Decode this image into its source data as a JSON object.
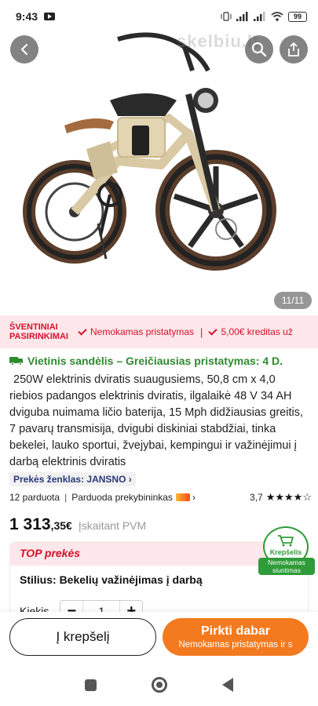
{
  "status_bar": {
    "time": "9:43",
    "battery": "99",
    "icons": [
      "youtube-icon",
      "vibrate-icon",
      "signal-icon",
      "signal-icon",
      "wifi-icon",
      "battery-icon"
    ]
  },
  "hero": {
    "watermark": "skelbiu.lt",
    "image_counter": "11/11",
    "icons": [
      "back-icon",
      "search-icon",
      "share-icon"
    ]
  },
  "promo": {
    "title_line1": "ŠVENTINIAI",
    "title_line2": "PASIRINKIMAI",
    "item1": "Nemokamas pristatymas",
    "separator": "|",
    "item2": "5,00€ kreditas už"
  },
  "product": {
    "warehouse": "Vietinis sandėlis – Greičiausias pristatymas: 4 D.",
    "description": "250W elektrinis dviratis suaugusiems, 50,8 cm x 4,0 riebios padangos elektrinis dviratis, ilgalaikė 48 V 34 AH dviguba nuimama ličio baterija, 15 Mph didžiausias greitis, 7 pavarų transmisija, dvigubi diskiniai stabdžiai, tinka bekelei, lauko sportui, žvejybai, kempingui ir važinėjimui į darbą elektrinis dviratis",
    "brand_label": "Prekės ženklas:",
    "brand_value": "JANSNO",
    "sold": "12 parduota",
    "sold_by": "Parduoda prekybininkas",
    "rating": "3,7",
    "stars": "★★★★☆",
    "price_main": "1 313",
    "price_cents": ",35€",
    "price_vat": "Įskaitant PVM"
  },
  "top_card": {
    "title": "TOP prekės",
    "style_label": "Stilius:",
    "style_value": "Bekelių važinėjimas į darbą",
    "qty_label": "Kiekis",
    "qty_minus": "−",
    "qty_value": "1",
    "qty_plus": "+"
  },
  "cart_badge": {
    "label": "Krepšelis",
    "ribbon_line1": "Nemokamas",
    "ribbon_line2": "siuntimas"
  },
  "actions": {
    "add_to_cart": "Į krepšelį",
    "buy_now": "Pirkti dabar",
    "buy_now_sub": "Nemokamas pristatymas ir s"
  },
  "colors": {
    "accent_orange": "#f47a1f",
    "promo_red": "#d6112b",
    "promo_bg": "#fde7ea",
    "warehouse_green": "#2f8a2f",
    "brand_blue": "#2a3a7a"
  }
}
